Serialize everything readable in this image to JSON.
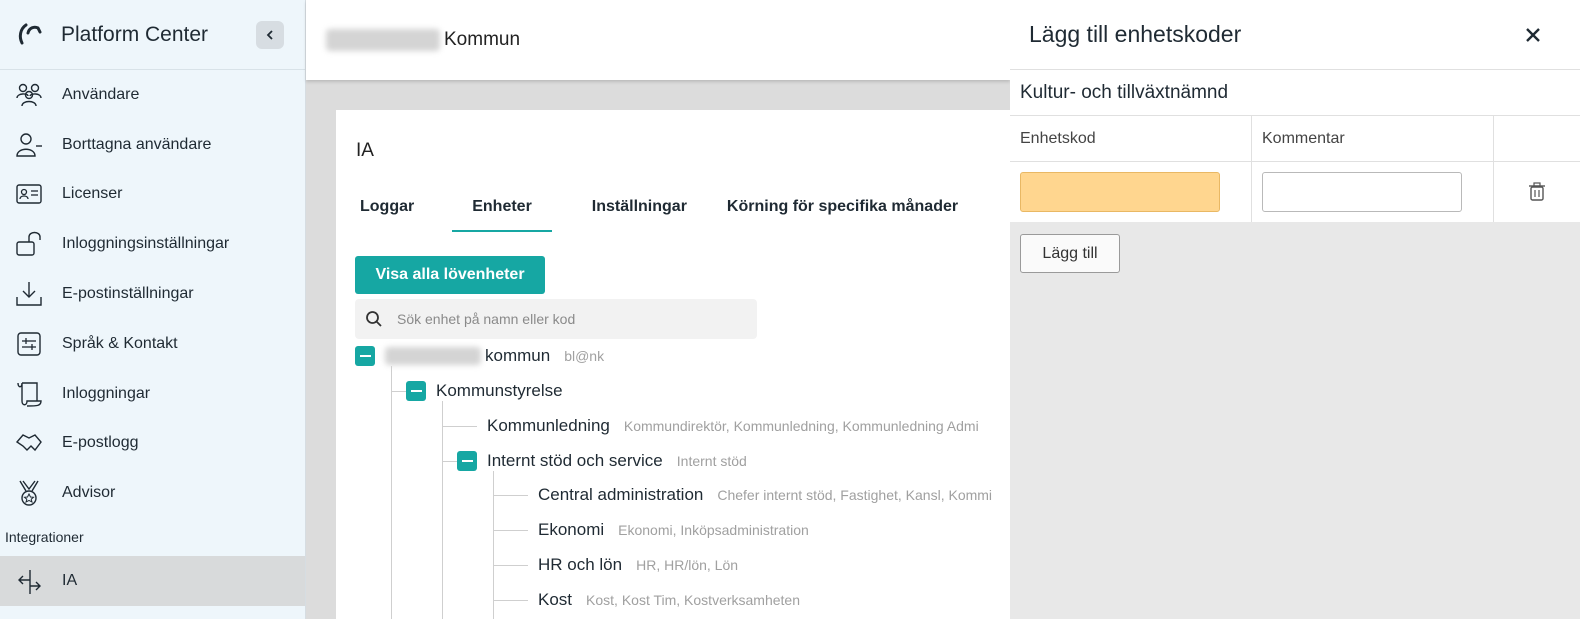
{
  "app": {
    "name": "Platform Center"
  },
  "sidebar": {
    "items": [
      {
        "label": "Användare",
        "icon": "users-icon"
      },
      {
        "label": "Borttagna användare",
        "icon": "user-removed-icon"
      },
      {
        "label": "Licenser",
        "icon": "id-card-icon"
      },
      {
        "label": "Inloggningsinställningar",
        "icon": "unlock-icon"
      },
      {
        "label": "E-postinställningar",
        "icon": "download-tray-icon"
      },
      {
        "label": "Språk & Kontakt",
        "icon": "sliders-icon"
      },
      {
        "label": "Inloggningar",
        "icon": "scroll-icon"
      },
      {
        "label": "E-postlogg",
        "icon": "handshake-icon"
      },
      {
        "label": "Advisor",
        "icon": "medal-icon"
      }
    ],
    "section_label": "Integrationer",
    "integration_item": {
      "label": "IA",
      "icon": "split-arrows-icon"
    }
  },
  "header": {
    "org_suffix": "Kommun"
  },
  "main": {
    "title": "IA",
    "tabs": [
      "Loggar",
      "Enheter",
      "Inställningar",
      "Körning för specifika månader"
    ],
    "active_tab": "Enheter",
    "show_leaves_button": "Visa alla lövenheter",
    "search_placeholder": "Sök enhet på namn eller kod"
  },
  "tree": {
    "root": {
      "name": "kommun",
      "meta": "bl@nk"
    },
    "level1": {
      "name": "Kommunstyrelse"
    },
    "kommunledning": {
      "name": "Kommunledning",
      "meta": "Kommundirektör, Kommunledning, Kommunledning Admi"
    },
    "internt": {
      "name": "Internt stöd och service",
      "meta": "Internt stöd"
    },
    "children": [
      {
        "name": "Central administration",
        "meta": "Chefer internt stöd, Fastighet, Kansl, Kommi"
      },
      {
        "name": "Ekonomi",
        "meta": "Ekonomi, Inköpsadministration"
      },
      {
        "name": "HR och lön",
        "meta": "HR, HR/lön, Lön"
      },
      {
        "name": "Kost",
        "meta": "Kost, Kost Tim, Kostverksamheten"
      }
    ]
  },
  "panel": {
    "title": "Lägg till enhetskoder",
    "unit_name": "Kultur- och tillväxtnämnd",
    "columns": [
      "Enhetskod",
      "Kommentar"
    ],
    "add_button": "Lägg till",
    "highlight_color": "#ffd68f"
  },
  "colors": {
    "accent": "#16a7a3",
    "sidebar_bg": "#eef6fb"
  }
}
